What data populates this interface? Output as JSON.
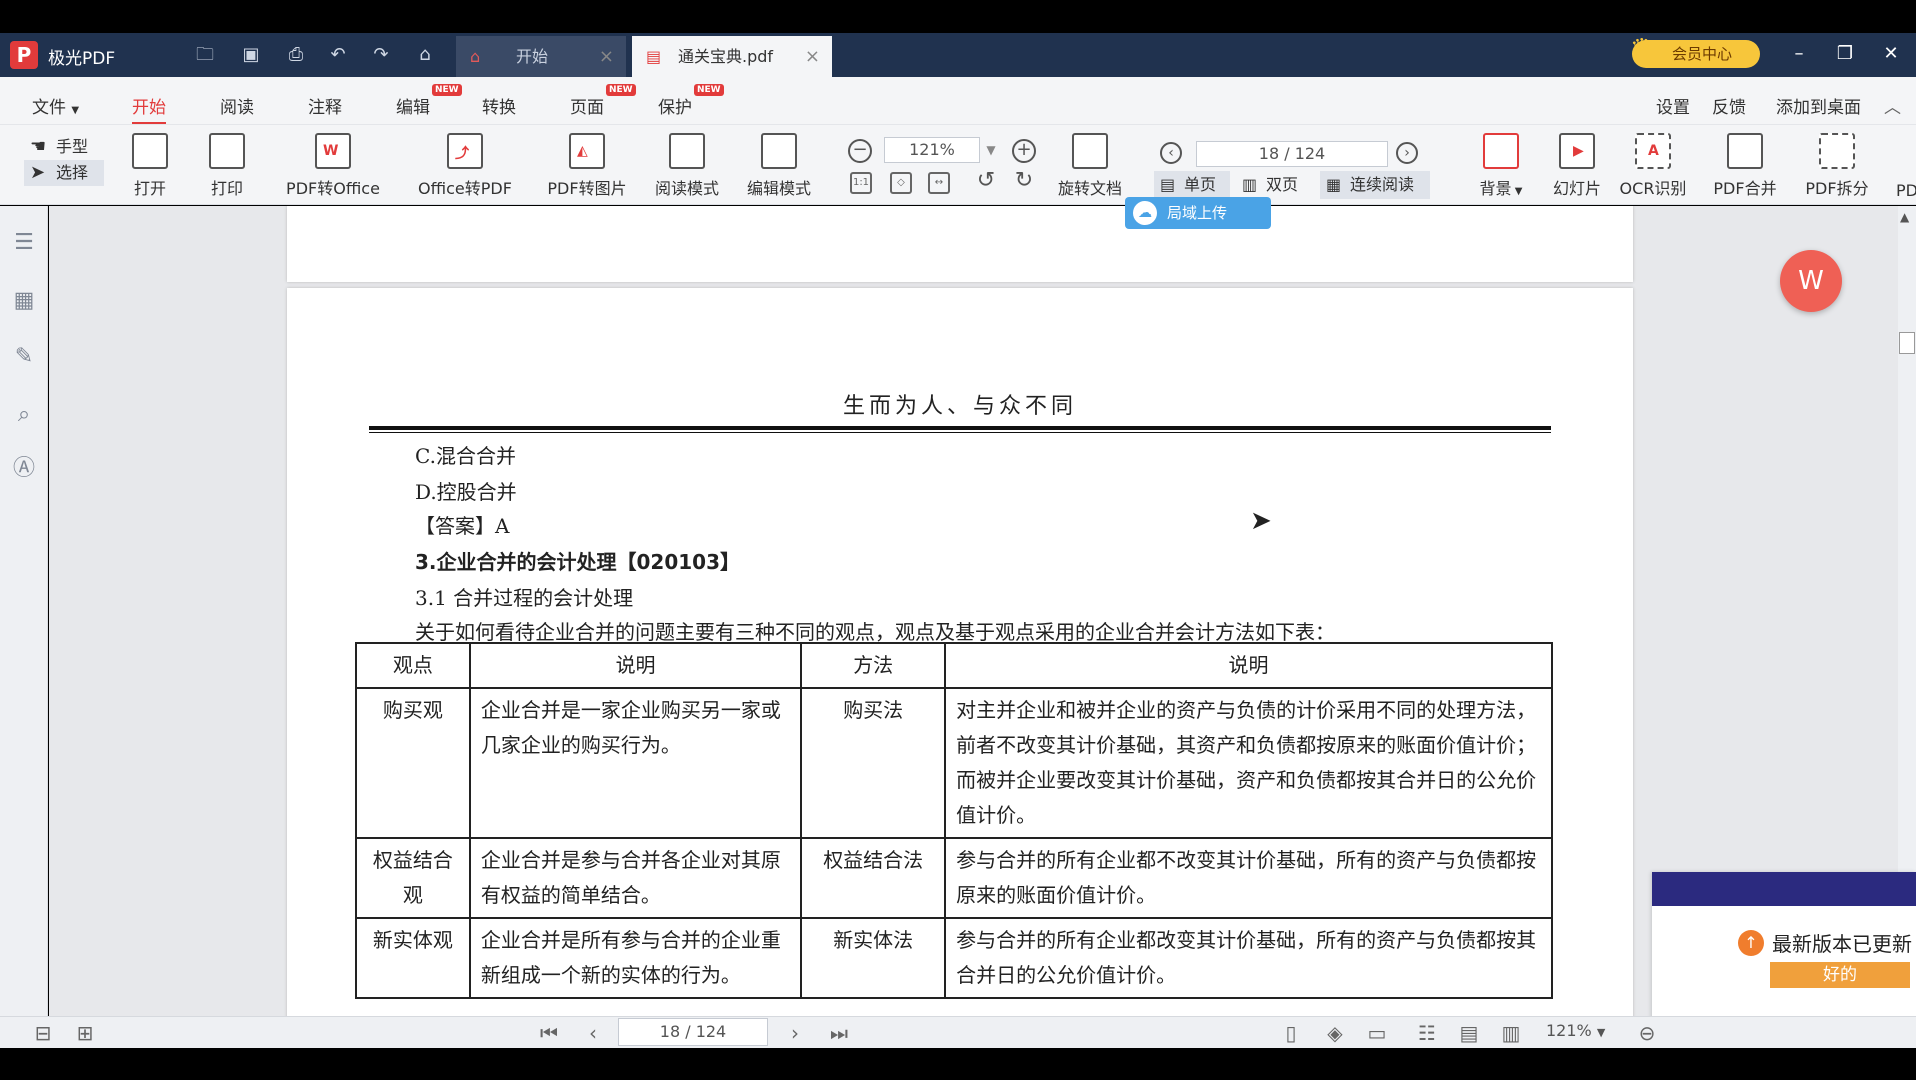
{
  "app": {
    "name": "极光PDF",
    "logo_letter": "P"
  },
  "tabs": [
    {
      "label": "开始",
      "icon": "home-icon"
    },
    {
      "label": "通关宝典.pdf",
      "icon": "pdf-icon"
    }
  ],
  "vip": {
    "label": "会员中心"
  },
  "menu": {
    "items": [
      "文件",
      "开始",
      "阅读",
      "注释",
      "编辑",
      "转换",
      "页面",
      "保护"
    ],
    "new_badge": "NEW",
    "right": [
      "设置",
      "反馈",
      "添加到桌面"
    ]
  },
  "toolbar": {
    "hand": "手型",
    "select": "选择",
    "tools": [
      "打开",
      "打印",
      "PDF转Office",
      "Office转PDF",
      "PDF转图片",
      "阅读模式",
      "编辑模式",
      "旋转文档"
    ],
    "zoom": "121%",
    "page": "18 / 124",
    "modes": [
      "单页",
      "双页",
      "连续阅读"
    ],
    "tools_right": [
      "背景",
      "幻灯片",
      "OCR识别",
      "PDF合并",
      "PDF拆分",
      "PD"
    ]
  },
  "upload_badge": "局域上传",
  "document": {
    "header": "生而为人、与众不同",
    "lines": [
      "C.混合合并",
      "D.控股合并",
      "【答案】A",
      "3.企业合并的会计处理【020103】",
      "3.1 合并过程的会计处理",
      "关于如何看待企业合并的问题主要有三种不同的观点，观点及基于观点采用的企业合并会计方法如下表："
    ],
    "table": {
      "headers": [
        "观点",
        "说明",
        "方法",
        "说明"
      ],
      "rows": [
        [
          "购买观",
          "企业合并是一家企业购买另一家或几家企业的购买行为。",
          "购买法",
          "对主并企业和被并企业的资产与负债的计价采用不同的处理方法，前者不改变其计价基础，其资产和负债都按原来的账面价值计价；而被并企业要改变其计价基础，资产和负债都按其合并日的公允价值计价。"
        ],
        [
          "权益结合观",
          "企业合并是参与合并各企业对其原有权益的简单结合。",
          "权益结合法",
          "参与合并的所有企业都不改变其计价基础，所有的资产与负债都按原来的账面价值计价。"
        ],
        [
          "新实体观",
          "企业合并是所有参与合并的企业重新组成一个新的实体的行为。",
          "新实体法",
          "参与合并的所有企业都改变其计价基础，所有的资产与负债都按其合并日的公允价值计价。"
        ]
      ]
    }
  },
  "update_panel": {
    "text": "最新版本已更新",
    "ok": "好的"
  },
  "statusbar": {
    "page": "18 / 124",
    "zoom": "121%"
  }
}
